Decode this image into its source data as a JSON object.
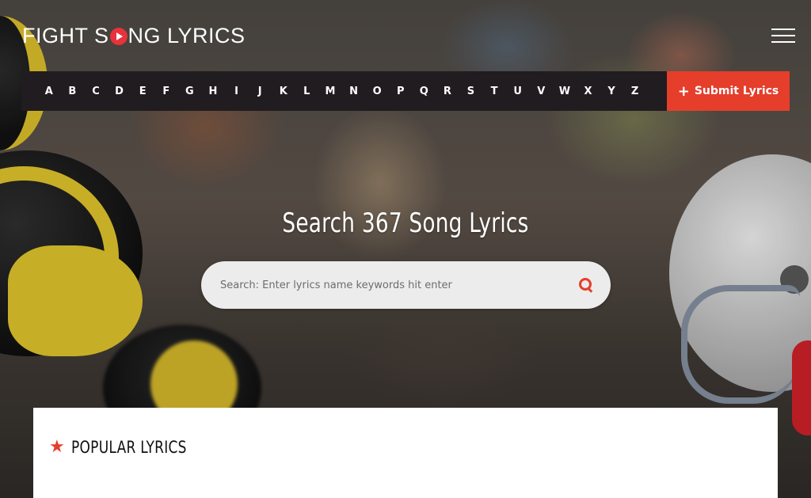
{
  "logo": {
    "part1": "FIGHT S",
    "part2": "NG LYRICS"
  },
  "nav": {
    "letters": [
      "A",
      "B",
      "C",
      "D",
      "E",
      "F",
      "G",
      "H",
      "I",
      "J",
      "K",
      "L",
      "M",
      "N",
      "O",
      "P",
      "Q",
      "R",
      "S",
      "T",
      "U",
      "V",
      "W",
      "X",
      "Y",
      "Z"
    ],
    "submit_label": "Submit Lyrics",
    "submit_icon": "plus-icon",
    "menu_icon": "hamburger-icon"
  },
  "hero": {
    "title": "Search 367 Song Lyrics",
    "search_placeholder": "Search: Enter lyrics name keywords hit enter",
    "search_icon": "search-icon"
  },
  "popular": {
    "heading": "POPULAR LYRICS",
    "icon": "star-icon"
  },
  "colors": {
    "accent": "#e53e2b",
    "nav_bg": "#211c20",
    "text_light": "#ffffff"
  }
}
